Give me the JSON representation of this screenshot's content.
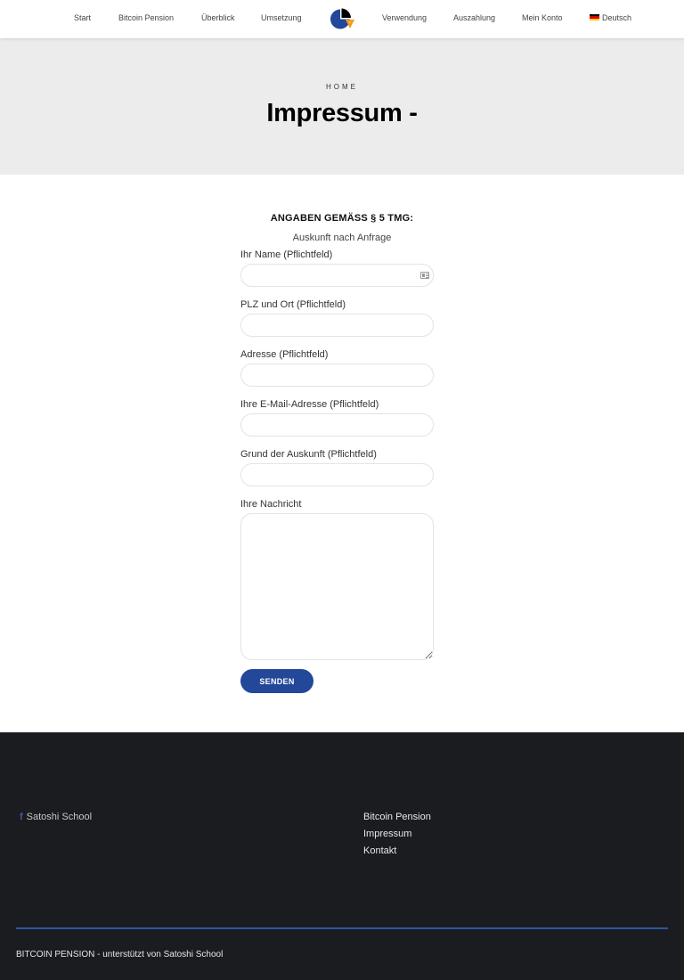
{
  "nav": {
    "items": [
      {
        "label": "Start"
      },
      {
        "label": "Bitcoin Pension"
      },
      {
        "label": "Überblick"
      },
      {
        "label": "Umsetzung"
      },
      {
        "label": "Verwendung"
      },
      {
        "label": "Auszahlung"
      },
      {
        "label": "Mein Konto"
      }
    ],
    "language": {
      "label": "Deutsch",
      "flag_icon": "german-flag-icon"
    },
    "logo_icon": "pie-chart-logo-icon"
  },
  "hero": {
    "breadcrumb": "HOME",
    "title": "Impressum -"
  },
  "content": {
    "heading": "ANGABEN GEMÄSS § 5 TMG:",
    "subheading": "Auskunft nach Anfrage",
    "form": {
      "fields": [
        {
          "label": "Ihr Name (Pflichtfeld)",
          "value": "",
          "icon": "contact-card-icon"
        },
        {
          "label": "PLZ und Ort (Pflichtfeld)",
          "value": ""
        },
        {
          "label": "Adresse (Pflichtfeld)",
          "value": ""
        },
        {
          "label": "Ihre E-Mail-Adresse (Pflichtfeld)",
          "value": ""
        },
        {
          "label": "Grund der Auskunft (Pflichtfeld)",
          "value": ""
        }
      ],
      "message": {
        "label": "Ihre Nachricht",
        "value": ""
      },
      "submit_label": "SENDEN"
    }
  },
  "footer": {
    "social": {
      "label": "Satoshi School",
      "icon": "facebook-icon"
    },
    "links": [
      {
        "label": "Bitcoin Pension"
      },
      {
        "label": "Impressum"
      },
      {
        "label": "Kontakt"
      }
    ],
    "copyright": "BITCOIN PENSION - unterstützt von Satoshi School"
  },
  "colors": {
    "accent": "#23489a",
    "footer_bg": "#1b1c20",
    "hero_bg": "#ececec"
  }
}
